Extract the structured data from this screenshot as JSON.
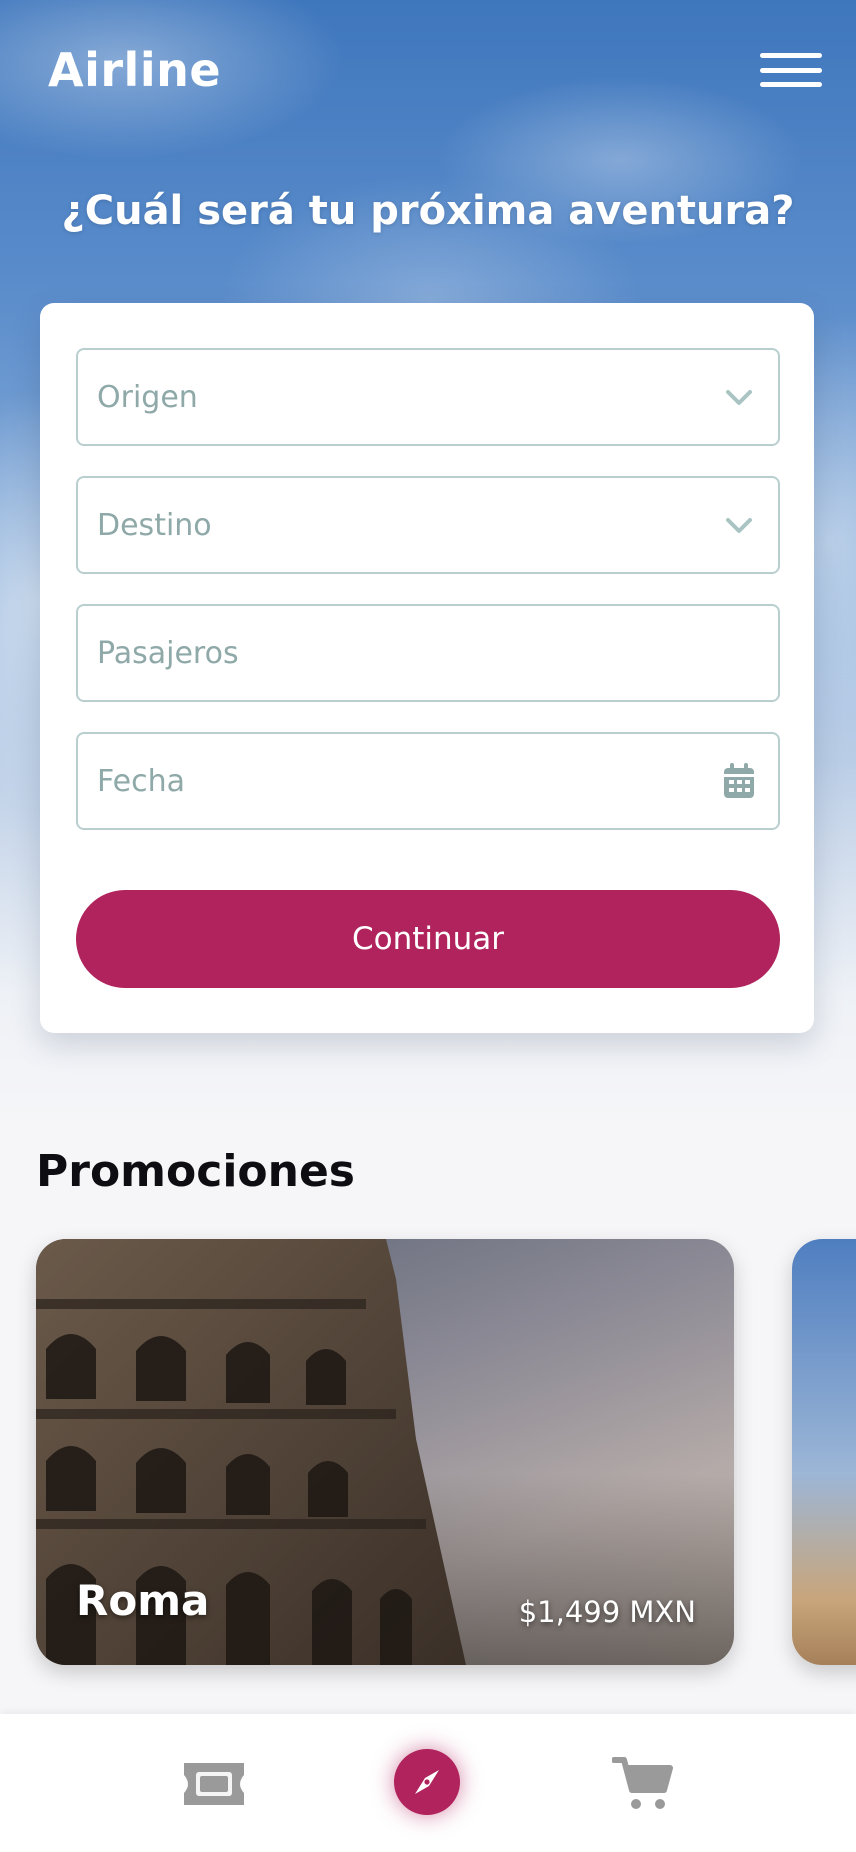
{
  "header": {
    "brand": "Airline",
    "menu_icon": "hamburger-menu-icon"
  },
  "hero": {
    "headline": "¿Cuál será tu próxima aventura?"
  },
  "search_form": {
    "origin": {
      "placeholder": "Origen",
      "icon": "chevron-down-icon",
      "value": ""
    },
    "destination": {
      "placeholder": "Destino",
      "icon": "chevron-down-icon",
      "value": ""
    },
    "passengers": {
      "placeholder": "Pasajeros",
      "value": ""
    },
    "date": {
      "placeholder": "Fecha",
      "icon": "calendar-icon",
      "value": ""
    },
    "submit_label": "Continuar"
  },
  "promotions": {
    "title": "Promociones",
    "items": [
      {
        "city": "Roma",
        "price": "$1,499 MXN"
      },
      {
        "city": "",
        "price": ""
      }
    ]
  },
  "bottom_nav": {
    "items": [
      {
        "icon": "ticket-icon",
        "active": false
      },
      {
        "icon": "compass-icon",
        "active": true
      },
      {
        "icon": "cart-icon",
        "active": false
      }
    ]
  },
  "colors": {
    "accent": "#b0235c",
    "field_border": "#b9cfce",
    "placeholder": "#8fa8a8",
    "sky": "#3f77bd"
  }
}
